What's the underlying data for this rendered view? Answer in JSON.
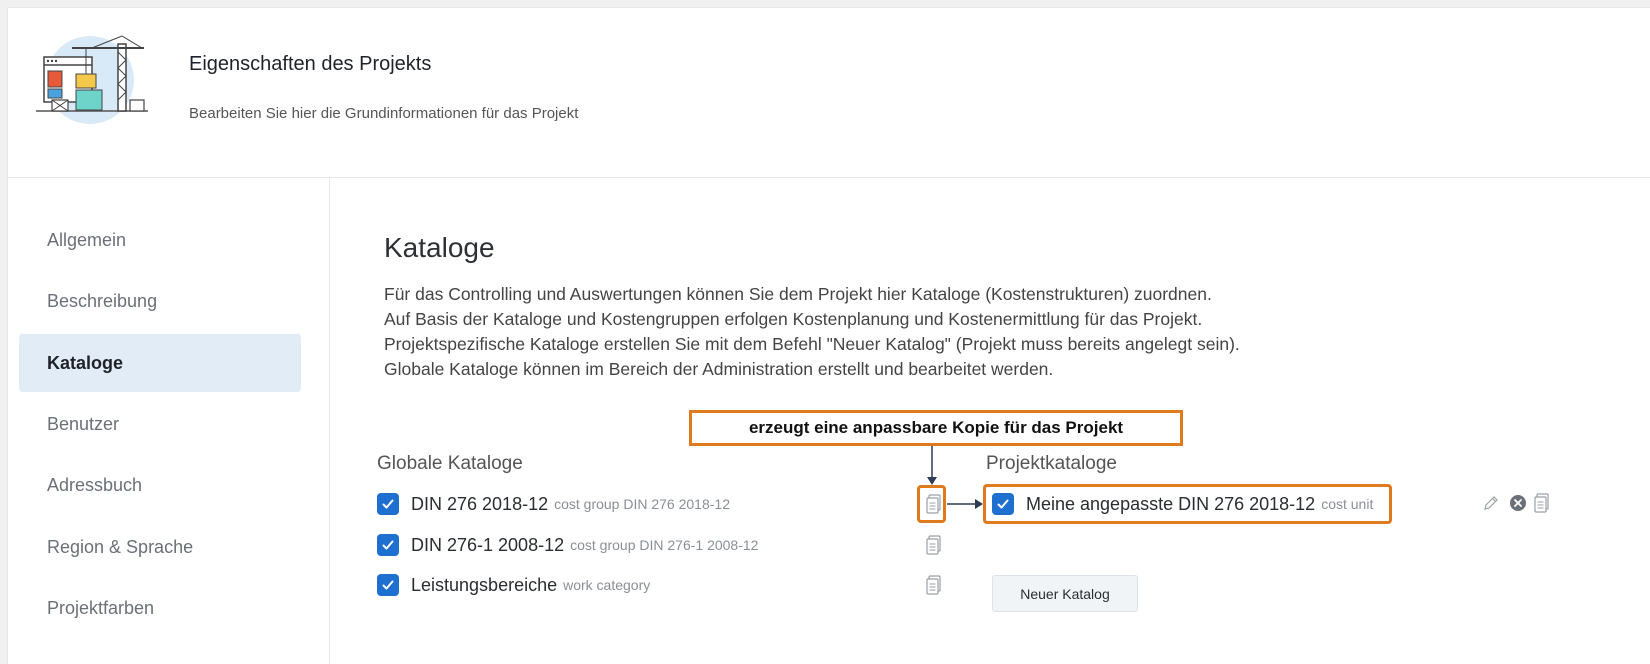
{
  "header": {
    "title": "Eigenschaften des Projekts",
    "subtitle": "Bearbeiten Sie hier die Grundinformationen für das Projekt"
  },
  "sidebar": {
    "items": [
      {
        "label": "Allgemein",
        "active": false
      },
      {
        "label": "Beschreibung",
        "active": false
      },
      {
        "label": "Kataloge",
        "active": true
      },
      {
        "label": "Benutzer",
        "active": false
      },
      {
        "label": "Adressbuch",
        "active": false
      },
      {
        "label": "Region & Sprache",
        "active": false
      },
      {
        "label": "Projektfarben",
        "active": false
      }
    ]
  },
  "main": {
    "title": "Kataloge",
    "description": [
      "Für das Controlling und Auswertungen können Sie dem Projekt hier Kataloge (Kostenstrukturen) zuordnen.",
      "Auf Basis der Kataloge und Kostengruppen erfolgen Kostenplanung und Kostenermittlung für das Projekt.",
      "Projektspezifische Kataloge erstellen Sie mit dem Befehl \"Neuer Katalog\" (Projekt muss bereits angelegt sein).",
      "Globale Kataloge können im Bereich der Administration erstellt und bearbeitet werden."
    ],
    "annotation": "erzeugt eine anpassbare Kopie für das Projekt",
    "global_catalogs": {
      "heading": "Globale Kataloge",
      "items": [
        {
          "name": "DIN 276 2018-12",
          "type": "cost group DIN 276 2018-12",
          "checked": true
        },
        {
          "name": "DIN 276-1 2008-12",
          "type": "cost group DIN 276-1 2008-12",
          "checked": true
        },
        {
          "name": "Leistungsbereiche",
          "type": "work category",
          "checked": true
        }
      ]
    },
    "project_catalogs": {
      "heading": "Projektkataloge",
      "items": [
        {
          "name": "Meine angepasste DIN 276 2018-12",
          "type": "cost unit",
          "checked": true
        }
      ],
      "new_button": "Neuer Katalog"
    }
  },
  "colors": {
    "accent": "#1e6fcf",
    "annotation": "#e07a1f",
    "active_nav_bg": "#e2ecf6"
  }
}
